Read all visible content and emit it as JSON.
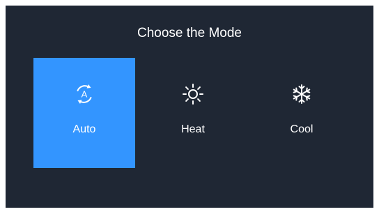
{
  "title": "Choose the Mode",
  "modes": [
    {
      "label": "Auto",
      "icon": "auto-cycle-icon",
      "selected": true
    },
    {
      "label": "Heat",
      "icon": "sun-icon",
      "selected": false
    },
    {
      "label": "Cool",
      "icon": "snowflake-icon",
      "selected": false
    }
  ],
  "auto_icon_letter": "A",
  "colors": {
    "background": "#1f2734",
    "selected": "#3395ff",
    "text": "#ffffff"
  }
}
